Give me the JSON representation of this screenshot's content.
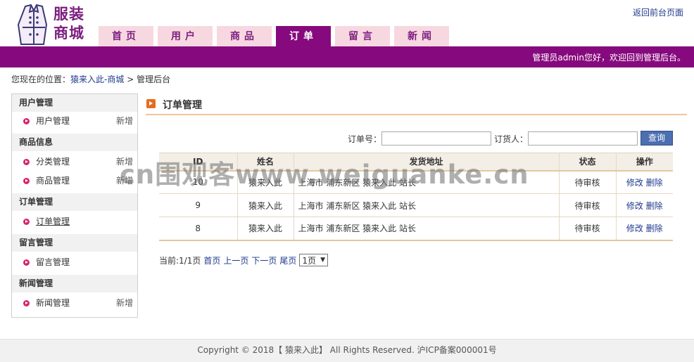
{
  "header": {
    "logo_text_line1": "服装",
    "logo_text_line2": "商城",
    "back_link": "返回前台页面",
    "welcome": "管理员admin您好，欢迎回到管理后台。",
    "accent_color": "#86097d",
    "tabs": [
      {
        "label": "首页",
        "active": false
      },
      {
        "label": "用户",
        "active": false
      },
      {
        "label": "商品",
        "active": false
      },
      {
        "label": "订单",
        "active": true
      },
      {
        "label": "留言",
        "active": false
      },
      {
        "label": "新闻",
        "active": false
      }
    ]
  },
  "breadcrumb": {
    "prefix": "您现在的位置：",
    "link": "猿来入此-商城",
    "separator": ">",
    "current": "管理后台"
  },
  "sidebar": {
    "groups": [
      {
        "title": "用户管理",
        "items": [
          {
            "label": "用户管理",
            "add": "新增"
          }
        ]
      },
      {
        "title": "商品信息",
        "items": [
          {
            "label": "分类管理",
            "add": "新增"
          },
          {
            "label": "商品管理",
            "add": "新增"
          }
        ]
      },
      {
        "title": "订单管理",
        "items": [
          {
            "label": "订单管理",
            "add": ""
          }
        ]
      },
      {
        "title": "留言管理",
        "items": [
          {
            "label": "留言管理",
            "add": ""
          }
        ]
      },
      {
        "title": "新闻管理",
        "items": [
          {
            "label": "新闻管理",
            "add": "新增"
          }
        ]
      }
    ]
  },
  "main": {
    "title": "订单管理",
    "search": {
      "order_no_label": "订单号：",
      "order_no_value": "",
      "orderer_label": "订货人：",
      "orderer_value": "",
      "button": "查询"
    },
    "table": {
      "headers": [
        "ID",
        "姓名",
        "发货地址",
        "状态",
        "操作"
      ],
      "rows": [
        {
          "id": "10",
          "name": "猿来入此",
          "address": "上海市 浦东新区 猿来入此 站长",
          "status": "待审核",
          "edit": "修改",
          "delete": "删除"
        },
        {
          "id": "9",
          "name": "猿来入此",
          "address": "上海市 浦东新区 猿来入此 站长",
          "status": "待审核",
          "edit": "修改",
          "delete": "删除"
        },
        {
          "id": "8",
          "name": "猿来入此",
          "address": "上海市 浦东新区 猿来入此 站长",
          "status": "待审核",
          "edit": "修改",
          "delete": "删除"
        }
      ]
    },
    "pager": {
      "current": "当前:1/1页",
      "first": "首页",
      "prev": "上一页",
      "next": "下一页",
      "last": "尾页",
      "select_value": "1页"
    }
  },
  "footer": {
    "text": "Copyright © 2018【 猿来入此】 All Rights Reserved. 沪ICP备案000001号"
  },
  "watermark": "cn围观客www.weiguanke.cn"
}
